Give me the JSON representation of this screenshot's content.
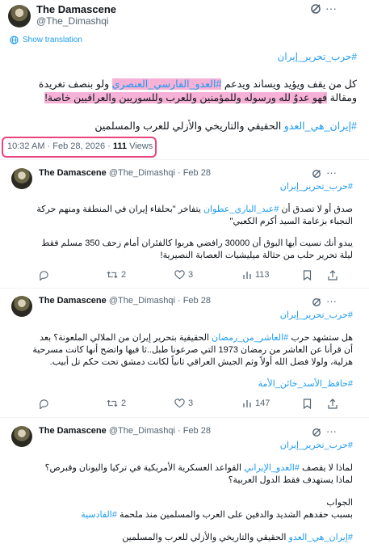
{
  "main": {
    "name": "The Damascene",
    "handle": "@The_Dimashqi",
    "translate": "Show translation",
    "hashtag_top": "#حرب_تحرير_إيران",
    "body_line1_pre": "كل من يقف ويؤيد ويساند ويدعم",
    "body_line1_tag": "#العدو_الفارسي_العنصري",
    "body_line1_post": "ولو بنصف تغريدة",
    "body_line2_pre": "ومقالة",
    "body_line2_hl": "فهو عدوٌ لله ورسوله وللمؤمنين وللعرب وللسوريين والعراقيين خاصة!",
    "body_line3_tag": "#إيران_هي_العدو",
    "body_line3_rest": "الحقيقي والتاريخي والأزلي للعرب والمسلمين",
    "time": "10:32 AM · Feb 28, 2026 · ",
    "views_count": "111",
    "views_label": "Views"
  },
  "replies": [
    {
      "name": "The Damascene",
      "handle": "@The_Dimashqi · Feb 28",
      "hashtag": "#حرب_تحرير_إيران",
      "line1_pre": "صدق أو لا تصدق أن",
      "line1_tag": "#عبد_الباري_عطوان",
      "line1_post": "يتفاخر \"بحلفاء إيران في المنطقة ومنهم حركة",
      "line2": "النجباء بزعامة السيد أكرم الكعبي\"",
      "line3": "يبدو أنك نسيت أيها البوق أن 30000 رافضي هربوا كالفئران أمام زحف 350 مسلم فقط",
      "line4": "ليلة تحرير حلب من حثالة ميليشيات العصابة النصيرية!",
      "reply_count": "",
      "retweet_count": "2",
      "like_count": "3",
      "view_count": "113"
    },
    {
      "name": "The Damascene",
      "handle": "@The_Dimashqi · Feb 28",
      "hashtag": "#حرب_تحرير_إيران",
      "line1_pre": "هل ستشهد حرب",
      "line1_tag": "#العاشر_من_رمضان",
      "line1_post": "الحقيقية بتحرير إيران من الملالي الملعونة؟ بعد",
      "line2": "أن قرأنا عن العاشر من رمضان 1973 التي صرعونا طبل..ثا فيها واتضح أنها كانت مسرحية",
      "line3": "هزلية، ولولا فضل الله أولاً وثم الجيش العراقي ثانياً لكانت دمشق تحت حكم تل أبيب.",
      "hashtag2": "#حافظ_الأسد_خائن_الأمة",
      "reply_count": "",
      "retweet_count": "2",
      "like_count": "3",
      "view_count": "147"
    },
    {
      "name": "The Damascene",
      "handle": "@The_Dimashqi · Feb 28",
      "hashtag": "#حرب_تحرير_إيران",
      "line1_pre": "لماذا لا يقصف",
      "line1_tag": "#العدو_الإيراني",
      "line1_post": "القواعد العسكرية الأمريكية في تركيا واليونان وقبرص؟",
      "line2": "لماذا يستهدف فقط الدول العربية؟",
      "line3": "الجواب",
      "line4_pre": "بسبب حقدهم الشديد والدفين على العرب والمسلمين منذ ملحمة",
      "line4_tag": "#القادسية",
      "line5_tag": "#إيران_هي_العدو",
      "line5_rest": "الحقيقي والتاريخي والأزلي للعرب والمسلمين"
    }
  ]
}
